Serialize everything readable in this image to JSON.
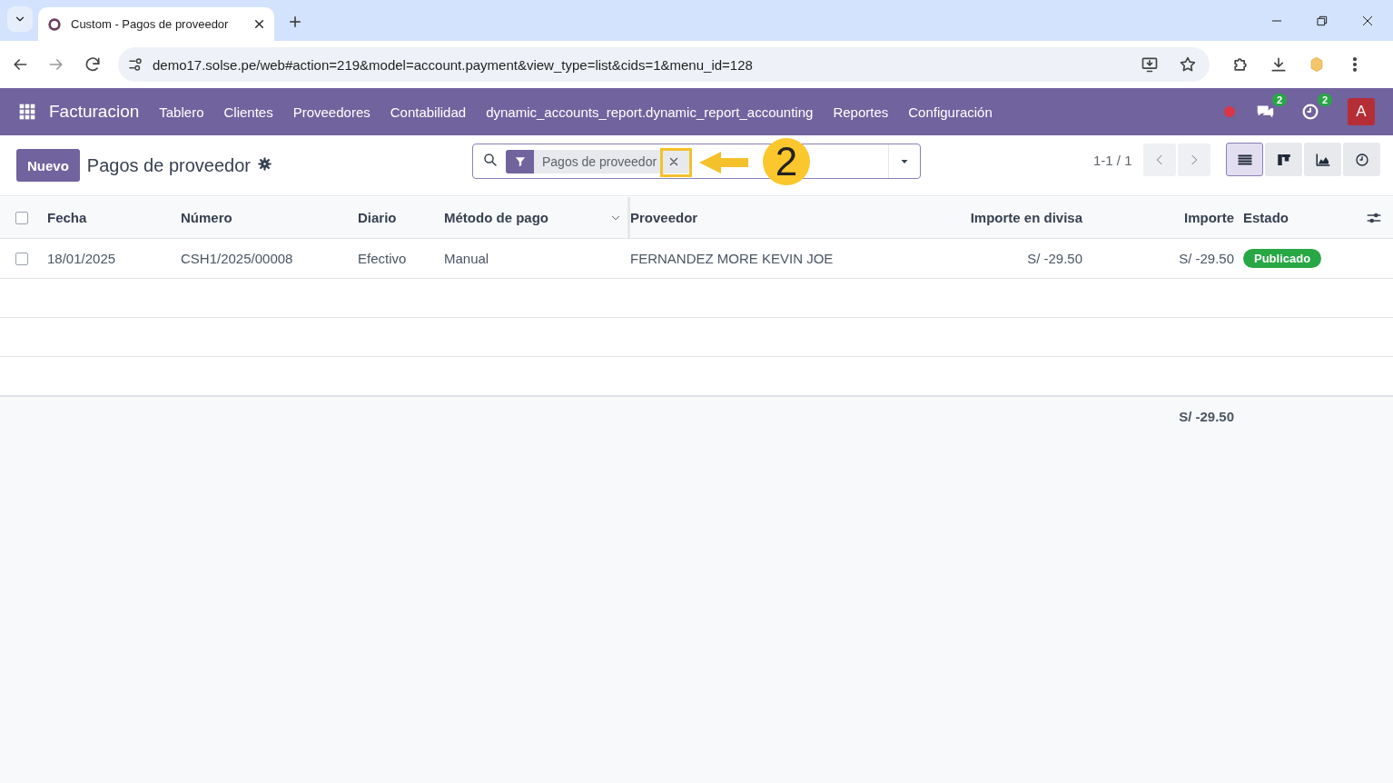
{
  "browser": {
    "tab": {
      "title": "Custom - Pagos de proveedor"
    },
    "url": "demo17.solse.pe/web#action=219&model=account.payment&view_type=list&cids=1&menu_id=128"
  },
  "navbar": {
    "app": "Facturacion",
    "menu": [
      "Tablero",
      "Clientes",
      "Proveedores",
      "Contabilidad",
      "dynamic_accounts_report.dynamic_report_accounting",
      "Reportes",
      "Configuración"
    ],
    "messages_badge": "2",
    "activities_badge": "2",
    "avatar": "A"
  },
  "control_panel": {
    "new_button": "Nuevo",
    "title": "Pagos de proveedor",
    "facet": "Pagos de proveedor",
    "pager": "1-1 / 1",
    "views": [
      {
        "kind": "list",
        "selected": true
      },
      {
        "kind": "kanban",
        "selected": false
      },
      {
        "kind": "graph",
        "selected": false
      },
      {
        "kind": "activity",
        "selected": false
      }
    ]
  },
  "annotation": {
    "step": "2"
  },
  "table": {
    "select_all_checked": false,
    "columns": [
      "Fecha",
      "Número",
      "Diario",
      "Método de pago",
      "Proveedor",
      "Importe en divisa",
      "Importe",
      "Estado"
    ],
    "rows": [
      {
        "checked": false,
        "cells": [
          "18/01/2025",
          "CSH1/2025/00008",
          "Efectivo",
          "Manual",
          "FERNANDEZ MORE KEVIN JOE",
          "S/ -29.50",
          "S/ -29.50"
        ],
        "status": "Publicado",
        "color": "#28a745"
      }
    ],
    "total": "S/ -29.50"
  }
}
